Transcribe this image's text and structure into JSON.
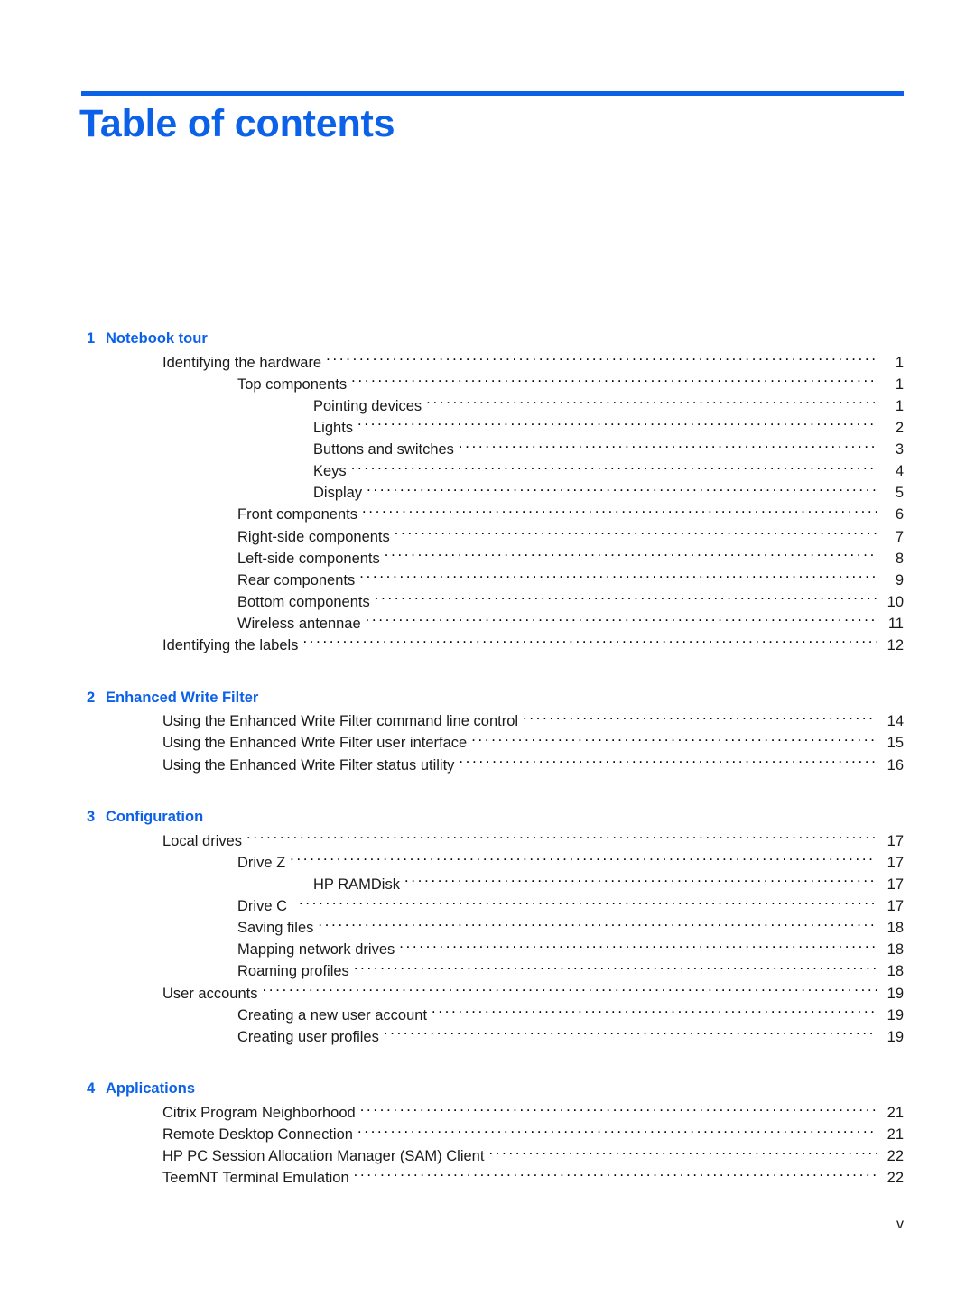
{
  "document": {
    "title": "Table of contents",
    "accent_color": "#0b61e8",
    "text_color": "#1a1a1a",
    "footer_page_number": "v"
  },
  "chapters": [
    {
      "number": "1",
      "title": "Notebook tour",
      "entries": [
        {
          "level": 1,
          "label": "Identifying the hardware",
          "page": "1"
        },
        {
          "level": 2,
          "label": "Top components",
          "page": "1"
        },
        {
          "level": 3,
          "label": "Pointing devices",
          "page": "1"
        },
        {
          "level": 3,
          "label": "Lights",
          "page": "2"
        },
        {
          "level": 3,
          "label": "Buttons and switches",
          "page": "3"
        },
        {
          "level": 3,
          "label": "Keys",
          "page": "4"
        },
        {
          "level": 3,
          "label": "Display",
          "page": "5"
        },
        {
          "level": 2,
          "label": "Front components",
          "page": "6"
        },
        {
          "level": 2,
          "label": "Right-side components",
          "page": "7"
        },
        {
          "level": 2,
          "label": "Left-side components",
          "page": "8"
        },
        {
          "level": 2,
          "label": "Rear components",
          "page": "9"
        },
        {
          "level": 2,
          "label": "Bottom components",
          "page": "10"
        },
        {
          "level": 2,
          "label": "Wireless antennae",
          "page": "11"
        },
        {
          "level": 1,
          "label": "Identifying the labels",
          "page": "12"
        }
      ]
    },
    {
      "number": "2",
      "title": "Enhanced Write Filter",
      "entries": [
        {
          "level": 1,
          "label": "Using the Enhanced Write Filter command line control",
          "page": "14"
        },
        {
          "level": 1,
          "label": "Using the Enhanced Write Filter user interface",
          "page": "15"
        },
        {
          "level": 1,
          "label": "Using the Enhanced Write Filter status utility",
          "page": "16"
        }
      ]
    },
    {
      "number": "3",
      "title": "Configuration",
      "entries": [
        {
          "level": 1,
          "label": "Local drives",
          "page": "17"
        },
        {
          "level": 2,
          "label": "Drive Z",
          "page": "17"
        },
        {
          "level": 3,
          "label": "HP RAMDisk",
          "page": "17"
        },
        {
          "level": 2,
          "label": "Drive C",
          "page": "17",
          "trailing_space": true
        },
        {
          "level": 2,
          "label": "Saving files",
          "page": "18"
        },
        {
          "level": 2,
          "label": "Mapping network drives",
          "page": "18"
        },
        {
          "level": 2,
          "label": "Roaming profiles",
          "page": "18"
        },
        {
          "level": 1,
          "label": "User accounts",
          "page": "19"
        },
        {
          "level": 2,
          "label": "Creating a new user account",
          "page": "19"
        },
        {
          "level": 2,
          "label": "Creating user profiles",
          "page": "19"
        }
      ]
    },
    {
      "number": "4",
      "title": "Applications",
      "entries": [
        {
          "level": 1,
          "label": "Citrix Program Neighborhood",
          "page": "21"
        },
        {
          "level": 1,
          "label": "Remote Desktop Connection",
          "page": "21"
        },
        {
          "level": 1,
          "label": "HP PC Session Allocation Manager (SAM) Client",
          "page": "22"
        },
        {
          "level": 1,
          "label": "TeemNT Terminal Emulation",
          "page": "22"
        }
      ]
    }
  ]
}
